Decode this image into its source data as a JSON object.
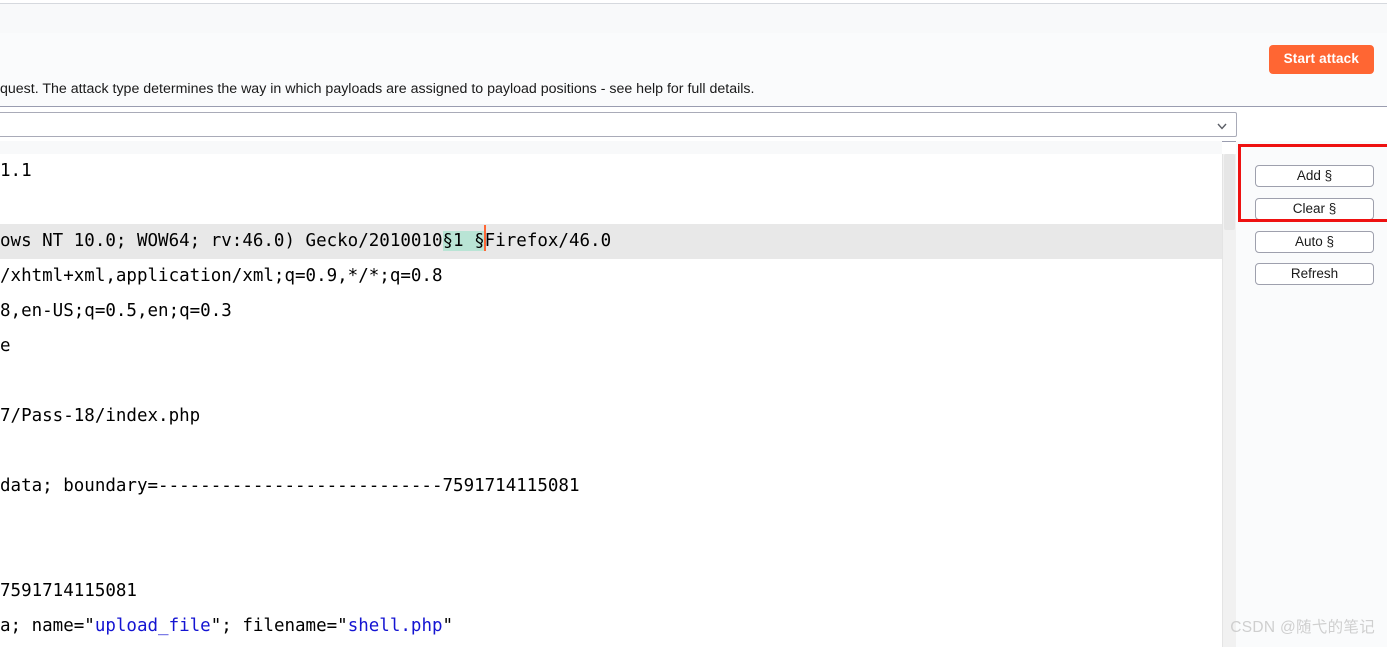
{
  "window": {
    "toolbar_placeholder": ""
  },
  "action_band": {
    "start_attack_label": "Start attack",
    "help_text": "quest. The attack type determines the way in which payloads are assigned to payload positions - see help for full details."
  },
  "attack_type": {
    "selected": "",
    "chevron_icon": "chevron-down-icon"
  },
  "editor": {
    "lines": [
      {
        "id": "line-1",
        "highlight": false,
        "segments": [
          {
            "text": "1.1"
          }
        ]
      },
      {
        "id": "line-2",
        "highlight": false,
        "segments": [
          {
            "text": ""
          }
        ]
      },
      {
        "id": "line-3",
        "highlight": true,
        "segments": [
          {
            "text": "ows NT 10.0; WOW64; rv:46.0) Gecko/2010010"
          },
          {
            "text": "§1 §",
            "style": "marker"
          },
          {
            "text": "",
            "style": "caret"
          },
          {
            "text": "Firefox/46.0"
          }
        ]
      },
      {
        "id": "line-4",
        "highlight": false,
        "segments": [
          {
            "text": "/xhtml+xml,application/xml;q=0.9,*/*;q=0.8"
          }
        ]
      },
      {
        "id": "line-5",
        "highlight": false,
        "segments": [
          {
            "text": "8,en-US;q=0.5,en;q=0.3"
          }
        ]
      },
      {
        "id": "line-6",
        "highlight": false,
        "segments": [
          {
            "text": "e"
          }
        ]
      },
      {
        "id": "line-7",
        "highlight": false,
        "segments": [
          {
            "text": ""
          }
        ]
      },
      {
        "id": "line-8",
        "highlight": false,
        "segments": [
          {
            "text": "7/Pass-18/index.php"
          }
        ]
      },
      {
        "id": "line-9",
        "highlight": false,
        "segments": [
          {
            "text": ""
          }
        ]
      },
      {
        "id": "line-10",
        "highlight": false,
        "segments": [
          {
            "text": "data; boundary=---------------------------7591714115081"
          }
        ]
      },
      {
        "id": "line-11",
        "highlight": false,
        "segments": [
          {
            "text": ""
          }
        ]
      },
      {
        "id": "line-12",
        "highlight": false,
        "segments": [
          {
            "text": ""
          }
        ]
      },
      {
        "id": "line-13",
        "highlight": false,
        "segments": [
          {
            "text": "7591714115081"
          }
        ]
      },
      {
        "id": "line-14",
        "highlight": false,
        "segments": [
          {
            "text": "a; name=\""
          },
          {
            "text": "upload_file",
            "style": "str-blue"
          },
          {
            "text": "\"; filename=\""
          },
          {
            "text": "shell.php",
            "style": "str-blue"
          },
          {
            "text": "\""
          }
        ]
      }
    ]
  },
  "right_rail": {
    "buttons": [
      {
        "id": "add-marker",
        "label": "Add §"
      },
      {
        "id": "clear-markers",
        "label": "Clear §"
      },
      {
        "id": "auto-markers",
        "label": "Auto §"
      },
      {
        "id": "refresh",
        "label": "Refresh"
      }
    ]
  },
  "annotation": {
    "color": "#ee1111"
  },
  "watermark": {
    "text": "CSDN @随弋的笔记"
  },
  "colors": {
    "accent_orange": "#ff6633",
    "marker_green": "#b9e4d5",
    "row_highlight": "#e8e8e8",
    "annotation_red": "#ee1111",
    "string_blue": "#1414d2"
  }
}
